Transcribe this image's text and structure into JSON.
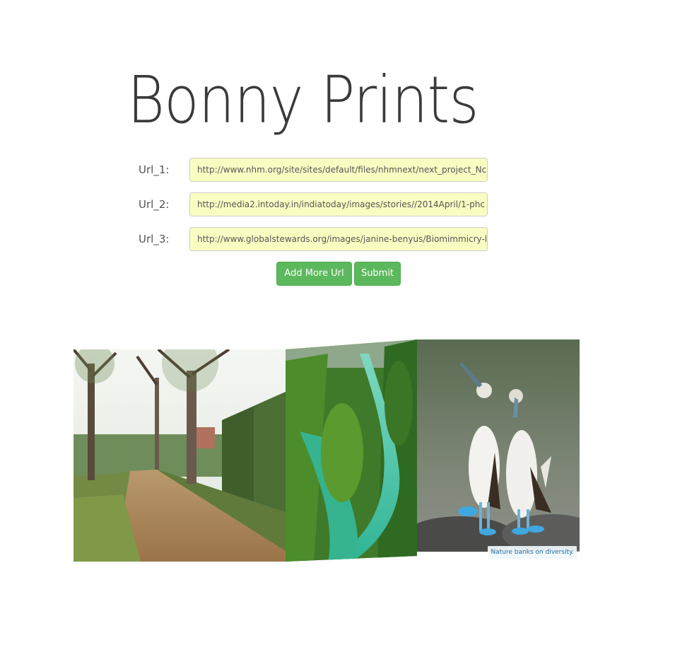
{
  "app": {
    "title": "Bonny Prints"
  },
  "form": {
    "rows": [
      {
        "label": "Url_1:",
        "value": "http://www.nhm.org/site/sites/default/files/nhmnext/next_project_Nc"
      },
      {
        "label": "Url_2:",
        "value": "http://media2.intoday.in/indiatoday/images/stories//2014April/1-phc"
      },
      {
        "label": "Url_3:",
        "value": "http://www.globalstewards.org/images/janine-benyus/Biomimmicry-l"
      }
    ],
    "add_more_label": "Add More Url",
    "submit_label": "Submit"
  },
  "gallery": {
    "caption": "Nature banks on diversity."
  },
  "colors": {
    "button_green": "#5cb85c",
    "input_background": "#fafdc2",
    "title_text": "#3a3a3a"
  }
}
